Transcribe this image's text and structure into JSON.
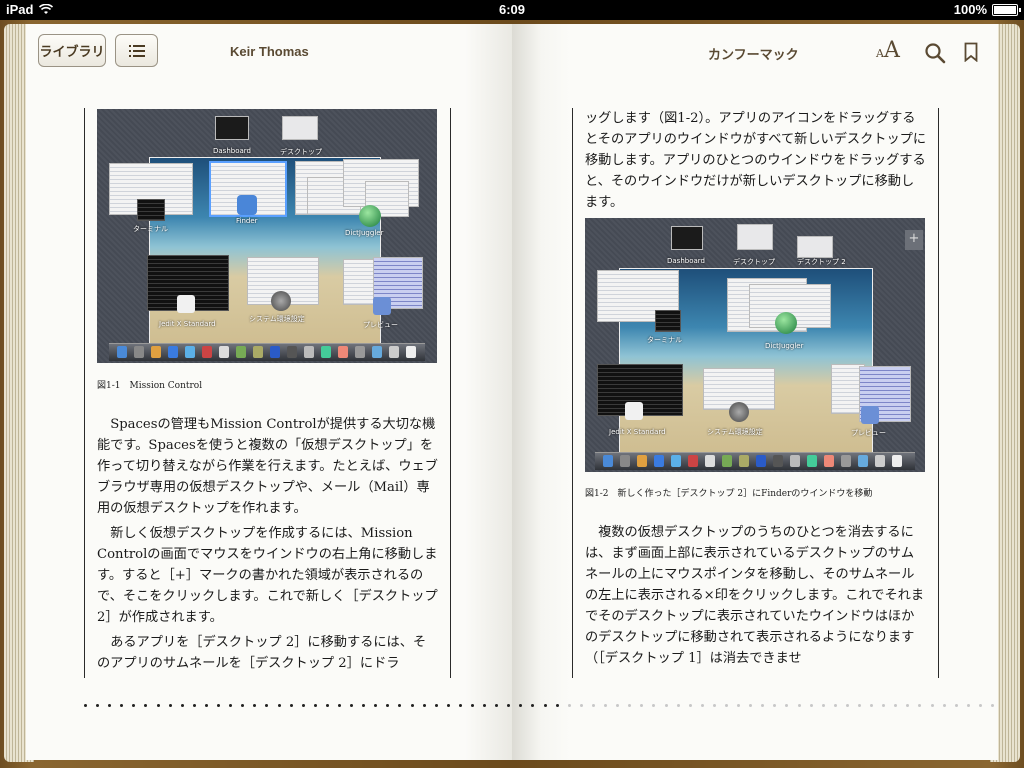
{
  "status_bar": {
    "carrier": "iPad",
    "time": "6:09",
    "battery": "100%",
    "battery_level": 1.0
  },
  "toolbar": {
    "library_label": "ライブラリ",
    "toc_icon": "list-icon",
    "author": "Keir Thomas",
    "chapter": "カンフーマック",
    "font_small": "A",
    "font_big": "A",
    "search_icon": "search-icon",
    "bookmark_icon": "bookmark-icon"
  },
  "left_page": {
    "figure": {
      "labels": {
        "dashboard": "Dashboard",
        "desktop": "デスクトップ",
        "finder": "Finder",
        "terminal": "ターミナル",
        "dictjuggler": "DictJuggler",
        "jedit": "Jedit X Standard",
        "sysprefs": "システム環境設定",
        "preview": "プレビュー"
      },
      "caption": "図1-1　Mission Control"
    },
    "paragraphs": [
      "Spacesの管理もMission Controlが提供する大切な機能です。Spacesを使うと複数の「仮想デスクトップ」を作って切り替えながら作業を行えます。たとえば、ウェブブラウザ専用の仮想デスクトップや、メール（Mail）専用の仮想デスクトップを作れます。",
      "新しく仮想デスクトップを作成するには、Mission Controlの画面でマウスをウインドウの右上角に移動します。すると［+］マークの書かれた領域が表示されるので、そこをクリックします。これで新しく［デスクトップ 2］が作成されます。",
      "あるアプリを［デスクトップ 2］に移動するには、そのアプリのサムネールを［デスクトップ 2］にドラ"
    ]
  },
  "right_page": {
    "top_paragraph": "ッグします（図1-2）。アプリのアイコンをドラッグするとそのアプリのウインドウがすべて新しいデスクトップに移動します。アプリのひとつのウインドウをドラッグすると、そのウインドウだけが新しいデスクトップに移動します。",
    "figure": {
      "labels": {
        "dashboard": "Dashboard",
        "desktop": "デスクトップ",
        "desktop2": "デスクトップ 2",
        "plus": "+",
        "terminal": "ターミナル",
        "dictjuggler": "DictJuggler",
        "jedit": "Jedit X Standard",
        "sysprefs": "システム環境設定",
        "preview": "プレビュー"
      },
      "caption": "図1-2　新しく作った［デスクトップ 2］にFinderのウインドウを移動"
    },
    "paragraphs": [
      "複数の仮想デスクトップのうちのひとつを消去するには、まず画面上部に表示されているデスクトップのサムネールの上にマウスポインタを移動し、そのサムネールの左上に表示される×印をクリックします。これでそれまでそのデスクトップに表示されていたウインドウはほかのデスクトップに移動されて表示されるようになります（［デスクトップ 1］は消去できませ"
    ]
  },
  "page_scrubber": {
    "total_dots": 76,
    "current_index": 39,
    "read_color": "#222222",
    "unread_color": "#c8c8c8"
  },
  "colors": {
    "frame": "#6b4a1c",
    "page": "#fbfbf8",
    "toolbar_text": "#5a4a33"
  }
}
